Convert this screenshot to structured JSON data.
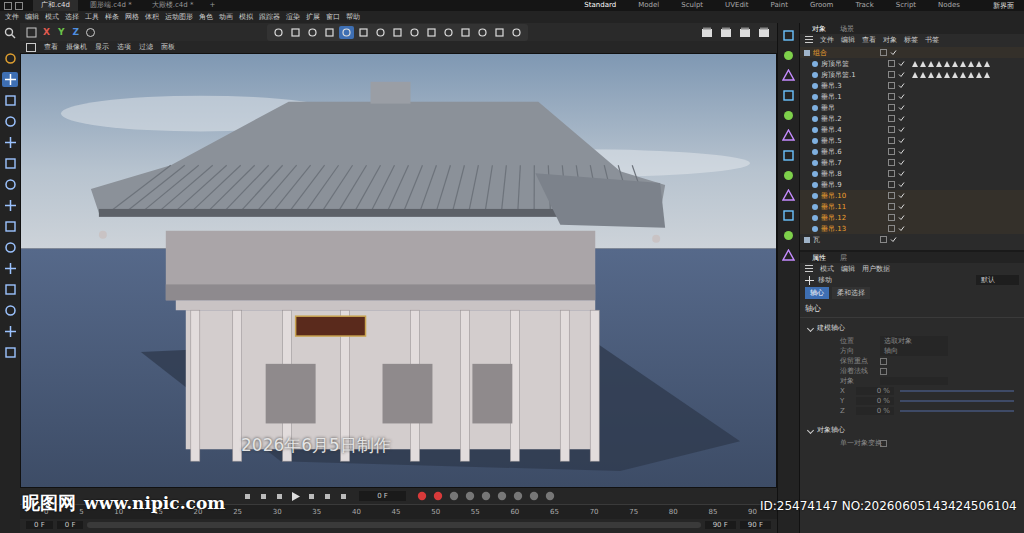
{
  "window": {
    "title": "广和.c4d"
  },
  "file_tabs": [
    {
      "label": "广和.c4d",
      "selected": true
    },
    {
      "label": "圆形端.c4d *",
      "selected": false
    },
    {
      "label": "大殿楼.c4d *",
      "selected": false
    }
  ],
  "new_tab": "+",
  "layouts": [
    {
      "label": "Standard",
      "selected": true
    },
    {
      "label": "Model",
      "selected": false
    },
    {
      "label": "Sculpt",
      "selected": false
    },
    {
      "label": "UVEdit",
      "selected": false
    },
    {
      "label": "Paint",
      "selected": false
    },
    {
      "label": "Groom",
      "selected": false
    },
    {
      "label": "Track",
      "selected": false
    },
    {
      "label": "Script",
      "selected": false
    },
    {
      "label": "Nodes",
      "selected": false
    }
  ],
  "layout_right": "新界面",
  "menu": [
    "文件",
    "编辑",
    "模式",
    "选择",
    "工具",
    "样条",
    "网格",
    "体积",
    "运动图形",
    "角色",
    "动画",
    "模拟",
    "跟踪器",
    "渲染",
    "扩展",
    "窗口",
    "帮助"
  ],
  "axis_labels": [
    {
      "label": "X",
      "color": "#e05a4f"
    },
    {
      "label": "Y",
      "color": "#6cc24a"
    },
    {
      "label": "Z",
      "color": "#4f8fe0"
    }
  ],
  "viewport_menu": [
    "查看",
    "摄像机",
    "显示",
    "选项",
    "过滤",
    "面板"
  ],
  "overlay_caption": "2026年6月5日制作",
  "object_manager": {
    "tabs": [
      {
        "label": "对象",
        "selected": true
      },
      {
        "label": "场景",
        "selected": false
      }
    ],
    "menu": [
      "文件",
      "编辑",
      "查看",
      "对象",
      "标签",
      "书签"
    ],
    "objects": [
      {
        "name": "组合",
        "kind": "group",
        "selected": true,
        "tags": 0
      },
      {
        "name": "房顶吊篮",
        "kind": "child",
        "selected": false,
        "tags": 10
      },
      {
        "name": "房顶吊篮.1",
        "kind": "child",
        "selected": false,
        "tags": 10
      },
      {
        "name": "垂吊.3",
        "kind": "child",
        "selected": false,
        "tags": 0
      },
      {
        "name": "垂吊.1",
        "kind": "child",
        "selected": false,
        "tags": 0
      },
      {
        "name": "垂吊",
        "kind": "child",
        "selected": false,
        "tags": 0
      },
      {
        "name": "垂吊.2",
        "kind": "child",
        "selected": false,
        "tags": 0
      },
      {
        "name": "垂吊.4",
        "kind": "child",
        "selected": false,
        "tags": 0
      },
      {
        "name": "垂吊.5",
        "kind": "child",
        "selected": false,
        "tags": 0
      },
      {
        "name": "垂吊.6",
        "kind": "child",
        "selected": false,
        "tags": 0
      },
      {
        "name": "垂吊.7",
        "kind": "child",
        "selected": false,
        "tags": 0
      },
      {
        "name": "垂吊.8",
        "kind": "child",
        "selected": false,
        "tags": 0
      },
      {
        "name": "垂吊.9",
        "kind": "child",
        "selected": false,
        "tags": 0
      },
      {
        "name": "垂吊.10",
        "kind": "child",
        "selected": true,
        "tags": 0
      },
      {
        "name": "垂吊.11",
        "kind": "child",
        "selected": true,
        "tags": 0
      },
      {
        "name": "垂吊.12",
        "kind": "child",
        "selected": true,
        "tags": 0
      },
      {
        "name": "垂吊.13",
        "kind": "child",
        "selected": true,
        "tags": 0
      },
      {
        "name": "瓦",
        "kind": "group",
        "selected": false,
        "tags": 0
      }
    ]
  },
  "attributes": {
    "tabs": [
      {
        "label": "属性",
        "selected": true
      },
      {
        "label": "层",
        "selected": false
      }
    ],
    "menu": [
      "模式",
      "编辑",
      "用户数据"
    ],
    "tool": "移动",
    "preset": "默认",
    "subtabs": [
      {
        "label": "轴心",
        "selected": true
      },
      {
        "label": "柔和选择",
        "selected": false
      }
    ],
    "heading": "轴心",
    "sections": [
      {
        "title": "建模轴心",
        "expanded": true,
        "fields": [
          {
            "label": "位置",
            "kind": "dropdown",
            "value": "选取对象"
          },
          {
            "label": "方向",
            "kind": "dropdown",
            "value": "轴向"
          },
          {
            "label": "保留重点",
            "kind": "checkbox",
            "checked": false
          },
          {
            "label": "沿着法线",
            "kind": "checkbox",
            "checked": false
          },
          {
            "label": "对象",
            "kind": "dropdown",
            "value": ""
          },
          {
            "label": "X",
            "kind": "slider",
            "value": "0 %",
            "level": 0
          },
          {
            "label": "Y",
            "kind": "slider",
            "value": "0 %",
            "level": 0
          },
          {
            "label": "Z",
            "kind": "slider",
            "value": "0 %",
            "level": 0
          }
        ]
      },
      {
        "title": "对象轴心",
        "expanded": true,
        "fields": [
          {
            "label": "单一对象变换",
            "kind": "checkbox",
            "checked": false
          }
        ]
      }
    ]
  },
  "timeline": {
    "frame": "0 F",
    "ruler": [
      "0",
      "5",
      "10",
      "15",
      "20",
      "25",
      "30",
      "35",
      "40",
      "45",
      "50",
      "55",
      "60",
      "65",
      "70",
      "75",
      "80",
      "85",
      "90"
    ],
    "range": [
      "0 F",
      "0 F",
      "90 F",
      "90 F"
    ]
  },
  "watermark": {
    "logo": "昵图网",
    "url": "www.nipic.com",
    "id": "ID:25474147 NO:20260605143424506104"
  }
}
